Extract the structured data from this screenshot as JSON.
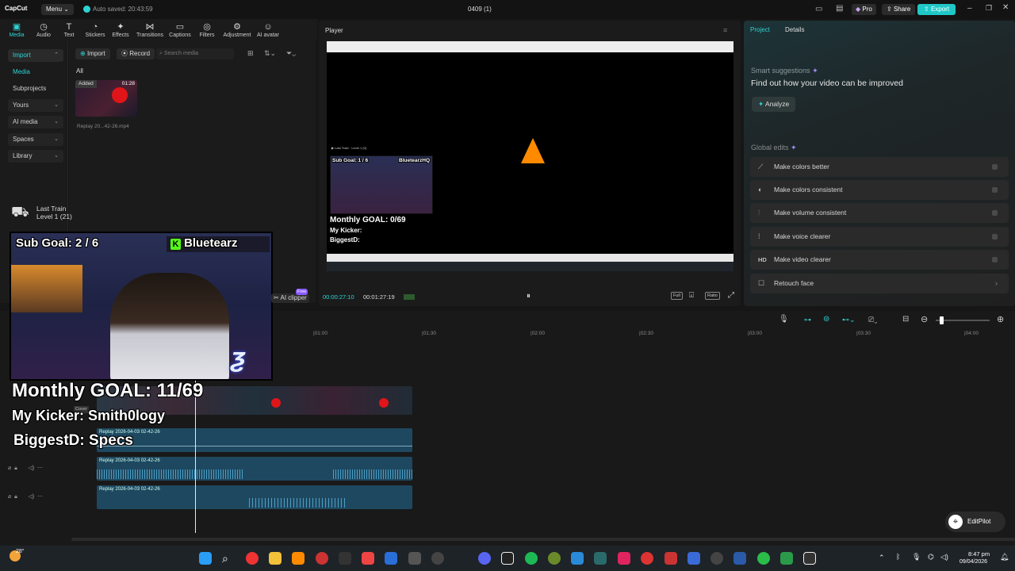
{
  "app": {
    "logo_label": "CapCut",
    "menu_label": "Menu",
    "autosave": "Auto saved: 20:43:59",
    "project_title": "0409 (1)",
    "pro_label": "Pro",
    "share_label": "Share",
    "export_label": "Export"
  },
  "toolbar": {
    "items": [
      {
        "label": "Media",
        "icon": "media-icon"
      },
      {
        "label": "Audio",
        "icon": "audio-icon"
      },
      {
        "label": "Text",
        "icon": "text-icon"
      },
      {
        "label": "Stickers",
        "icon": "stickers-icon"
      },
      {
        "label": "Effects",
        "icon": "effects-icon"
      },
      {
        "label": "Transitions",
        "icon": "transitions-icon"
      },
      {
        "label": "Captions",
        "icon": "captions-icon"
      },
      {
        "label": "Filters",
        "icon": "filters-icon"
      },
      {
        "label": "Adjustment",
        "icon": "adjustment-icon"
      },
      {
        "label": "AI avatar",
        "icon": "ai-avatar-icon"
      }
    ]
  },
  "sidebar": {
    "items": [
      {
        "label": "Import"
      },
      {
        "label": "Media"
      },
      {
        "label": "Subprojects"
      },
      {
        "label": "Yours"
      },
      {
        "label": "AI media"
      },
      {
        "label": "Spaces"
      },
      {
        "label": "Library"
      }
    ]
  },
  "media": {
    "import_label": "Import",
    "record_label": "Record",
    "search_placeholder": "Search media",
    "filter_all": "All",
    "clip": {
      "badge": "Added",
      "duration": "01:28",
      "name": "Replay 20...42-26.mp4"
    }
  },
  "overlay": {
    "game_line1": "Last Train",
    "game_line2": "Level 1 (21)",
    "sub_goal": "Sub Goal: 2 / 6",
    "channel": "Bluetearz",
    "monthly_goal": "Monthly GOAL: 11/69",
    "kicker": "My Kicker: Smith0logy",
    "biggest": "BiggestD: Specs",
    "ai_clipper": "AI clipper",
    "free_badge": "Free"
  },
  "player": {
    "title": "Player",
    "current_time": "00:00:27:10",
    "total_time": "00:01:27:19",
    "inner_sub_goal": "Sub Goal: 1 / 6",
    "inner_channel": "BluetearzHQ",
    "inner_monthly": "Monthly GOAL: 0/69",
    "inner_kicker": "My Kicker:",
    "inner_biggest": "BiggestD:",
    "inner_game": "Last Train",
    "inner_level": "Level 1 (0)",
    "full_label": "Full",
    "ratio_label": "Ratio"
  },
  "right": {
    "tab_project": "Project",
    "tab_details": "Details",
    "suggest_title": "Smart suggestions",
    "suggest_text": "Find out how your video can be improved",
    "analyze_label": "Analyze",
    "global_title": "Global edits",
    "edits": [
      {
        "label": "Make colors better",
        "icon": "wand-icon"
      },
      {
        "label": "Make colors consistent",
        "icon": "color-icon"
      },
      {
        "label": "Make volume consistent",
        "icon": "volume-sliders-icon"
      },
      {
        "label": "Make voice clearer",
        "icon": "voice-icon"
      },
      {
        "label": "Make video clearer",
        "icon": "hd-icon",
        "glyph": "HD"
      },
      {
        "label": "Retouch face",
        "icon": "retouch-icon"
      }
    ]
  },
  "timeline": {
    "ruler": [
      "|01:00",
      "|01:30",
      "|02:00",
      "|02:30",
      "|03:00",
      "|03:30",
      "|04:00"
    ],
    "cover_label": "Cover",
    "tracks": [
      {
        "label": "Replay 2026-04-03 02-42-26"
      },
      {
        "label": "Replay 2026-04-03 02-42-26"
      },
      {
        "label": "Replay 2026-04-03 02-42-26"
      }
    ],
    "editpilot_label": "EditPilot"
  },
  "taskbar": {
    "weather": "28°",
    "time": "8:47 pm",
    "date": "09/04/2026"
  },
  "colors": {
    "accent": "#2ed4d4",
    "export": "#1fc7c7",
    "track": "#1e4860"
  }
}
